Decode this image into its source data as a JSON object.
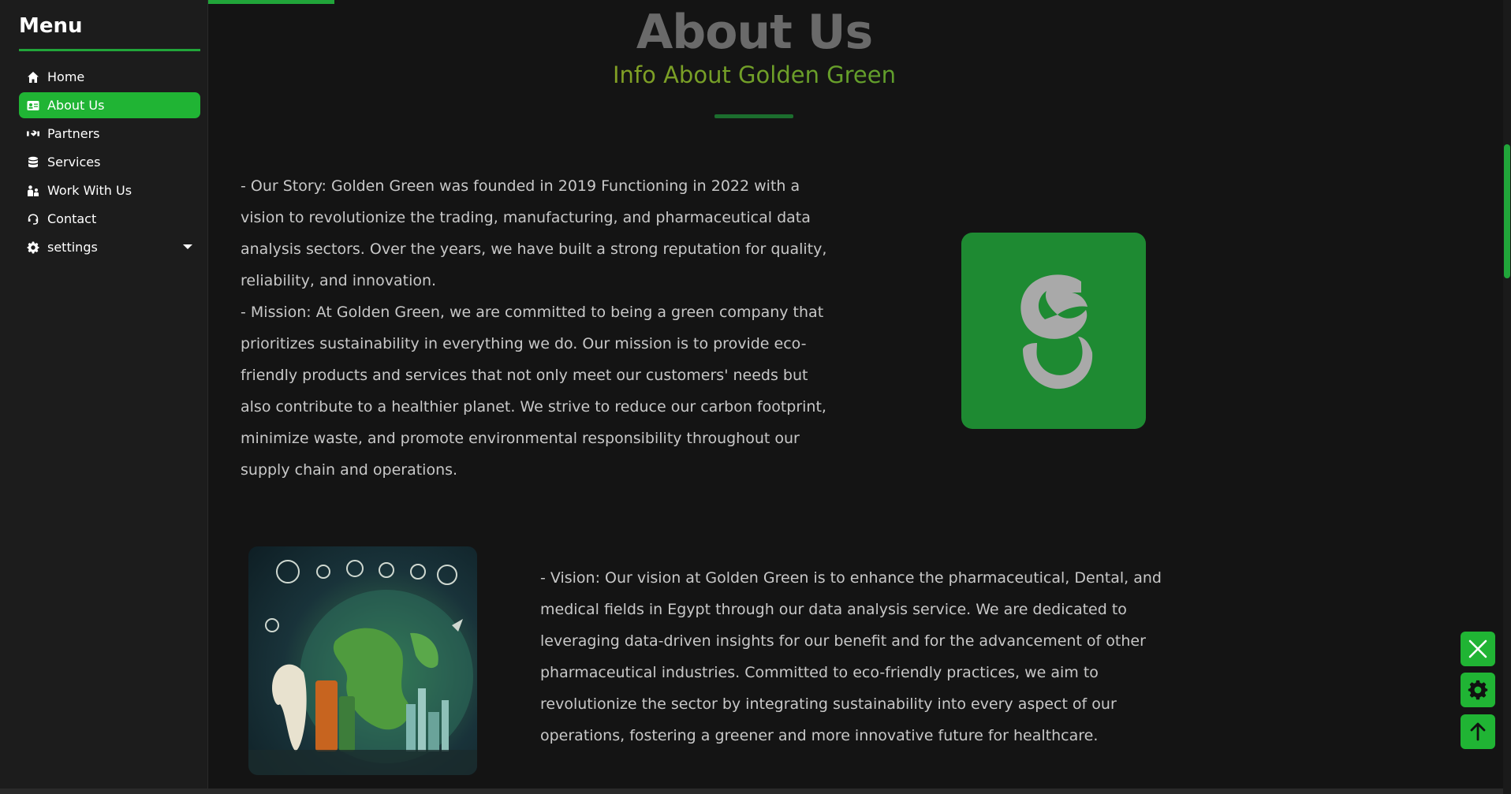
{
  "sidebar": {
    "title": "Menu",
    "items": [
      {
        "label": "Home",
        "icon": "home-icon"
      },
      {
        "label": "About Us",
        "icon": "id-card-icon",
        "active": true
      },
      {
        "label": "Partners",
        "icon": "handshake-icon"
      },
      {
        "label": "Services",
        "icon": "database-icon"
      },
      {
        "label": "Work With Us",
        "icon": "people-icon"
      },
      {
        "label": "Contact",
        "icon": "headset-icon"
      },
      {
        "label": "settings",
        "icon": "gear-icon",
        "has_dropdown": true
      }
    ]
  },
  "page": {
    "title": "About Us",
    "subtitle": "Info About Golden Green"
  },
  "story": {
    "paragraph1": "- Our Story: Golden Green was founded in 2019 Functioning in 2022 with a vision to revolutionize the trading, manufacturing, and pharmaceutical data analysis sectors. Over the years, we have built a strong reputation for quality, reliability, and innovation.",
    "paragraph2": "- Mission: At Golden Green, we are committed to being a green company that prioritizes sustainability in everything we do. Our mission is to provide eco-friendly products and services that not only meet our customers' needs but also contribute to a healthier planet. We strive to reduce our carbon footprint, minimize waste, and promote environmental responsibility throughout our supply chain and operations."
  },
  "vision": {
    "paragraph": "- Vision: Our vision at Golden Green is to enhance the pharmaceutical, Dental, and medical fields in Egypt through our data analysis service. We are dedicated to leveraging data-driven insights for our benefit and for the advancement of other pharmaceutical industries. Committed to eco-friendly practices, we aim to revolutionize the sector by integrating sustainability into every aspect of our operations, fostering a greener and more innovative future for healthcare."
  },
  "colors": {
    "accent": "#20b434",
    "logo_bg": "#1e8a32",
    "background": "#141414",
    "sidebar_bg": "#1c1c1c"
  },
  "floating_buttons": [
    "close-icon",
    "gear-icon",
    "arrow-up-icon"
  ]
}
